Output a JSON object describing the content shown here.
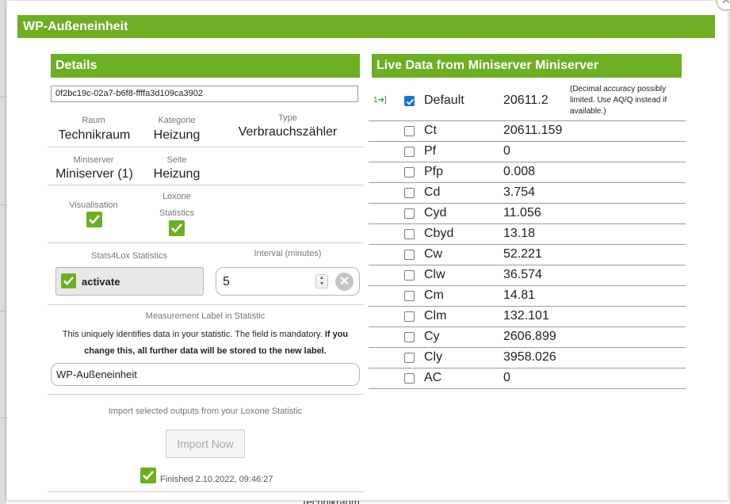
{
  "background": {
    "bottom_peek_text": "Technikraum"
  },
  "dialog": {
    "title": "WP-Außeneinheit",
    "close_icon": "close-icon",
    "accent_color": "#6daf23"
  },
  "details": {
    "header": "Details",
    "uuid": "0f2bc19c-02a7-b6f8-ffffa3d109ca3902",
    "raum_label": "Raum",
    "raum_value": "Technikraum",
    "kategorie_label": "Kategorie",
    "kategorie_value": "Heizung",
    "type_label": "Type",
    "type_value": "Verbrauchszähler",
    "miniserver_label": "Miniserver",
    "miniserver_value": "Miniserver (1)",
    "seite_label": "Seite",
    "seite_value": "Heizung",
    "visualisation_label": "Visualisation",
    "visualisation_checked": true,
    "loxone_label": "Loxone",
    "statistics_label": "Statistics",
    "statistics_checked": true,
    "stats4lox_label": "Stats4Lox Statistics",
    "activate_label": "activate",
    "activate_checked": true,
    "interval_label": "Interval (minutes)",
    "interval_value": "5",
    "measurement_label_title": "Measurement Label in Statistic",
    "measurement_desc_normal": "This uniquely identifies data in your statistic. The field is mandatory. ",
    "measurement_desc_bold": "If you change this, all further data will be stored to the new label.",
    "measurement_label_value": "WP-Außeneinheit",
    "import_text": "Import selected outputs from your Loxone Statistic",
    "import_button": "Import Now",
    "finished_checked": true,
    "finished_text": "Finished 2.10.2022, 09:46:27"
  },
  "live": {
    "header": "Live Data from Miniserver Miniserver",
    "link_label": "1",
    "note": "(Decimal accuracy possibly limited. Use AQ/Q instead if available.)",
    "checkbox_color": "#1a73d9",
    "rows": [
      {
        "name": "Default",
        "value": "20611.2",
        "checked": true
      },
      {
        "name": "Ct",
        "value": "20611.159",
        "checked": false
      },
      {
        "name": "Pf",
        "value": "0",
        "checked": false
      },
      {
        "name": "Pfp",
        "value": "0.008",
        "checked": false
      },
      {
        "name": "Cd",
        "value": "3.754",
        "checked": false
      },
      {
        "name": "Cyd",
        "value": "11.056",
        "checked": false
      },
      {
        "name": "Cbyd",
        "value": "13.18",
        "checked": false
      },
      {
        "name": "Cw",
        "value": "52.221",
        "checked": false
      },
      {
        "name": "Clw",
        "value": "36.574",
        "checked": false
      },
      {
        "name": "Cm",
        "value": "14.81",
        "checked": false
      },
      {
        "name": "Clm",
        "value": "132.101",
        "checked": false
      },
      {
        "name": "Cy",
        "value": "2606.899",
        "checked": false
      },
      {
        "name": "Cly",
        "value": "3958.026",
        "checked": false
      },
      {
        "name": "AC",
        "value": "0",
        "checked": false
      }
    ]
  }
}
